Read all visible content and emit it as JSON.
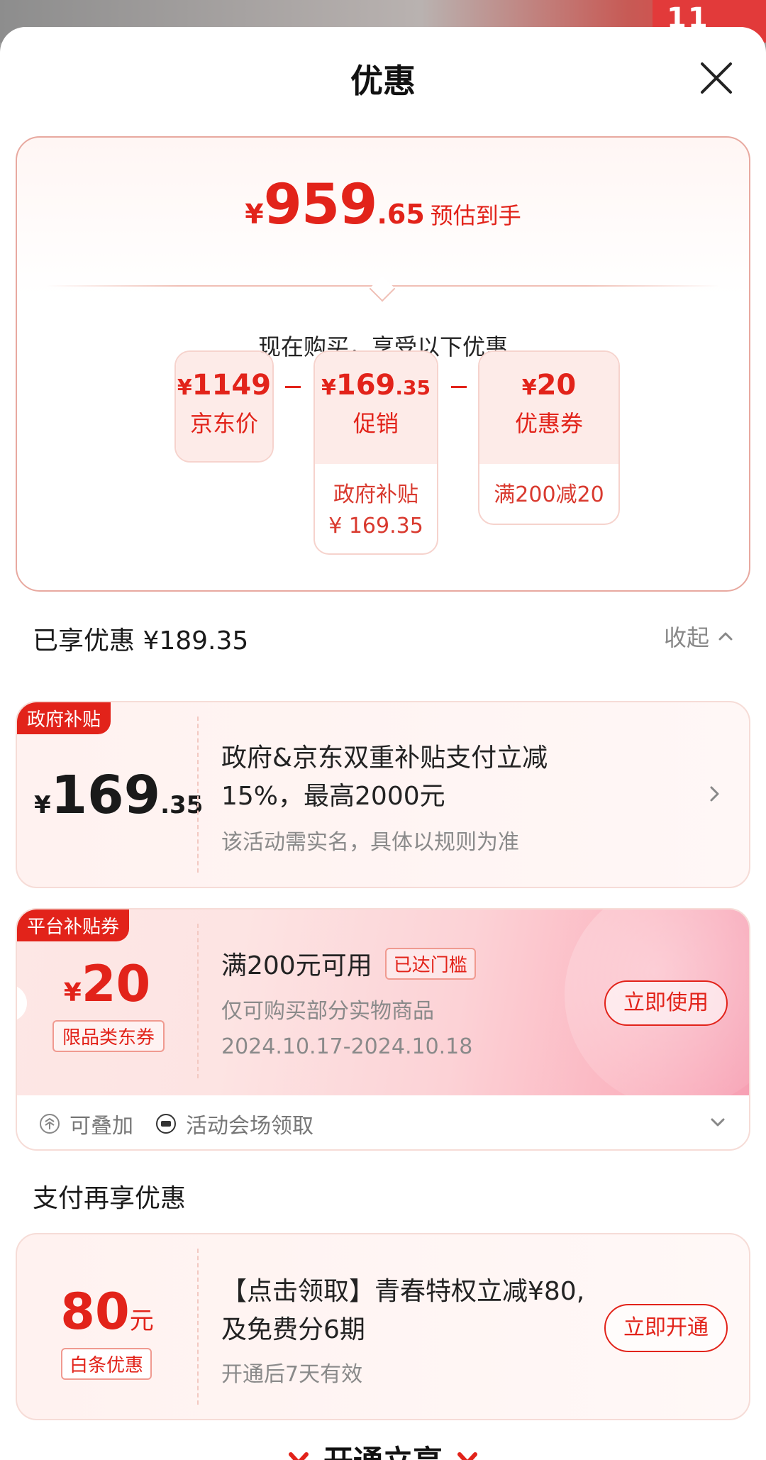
{
  "sheet": {
    "title": "优惠"
  },
  "summary": {
    "currency": "¥",
    "estimate_int": "959",
    "estimate_dec": ".65",
    "estimate_label": "预估到手",
    "buy_label": "现在购买，享受以下优惠",
    "boxes": [
      {
        "amount": "1149",
        "name": "京东价"
      },
      {
        "amount": "169",
        "amount_dec": ".35",
        "name": "促销",
        "detail_line1": "政府补贴",
        "detail_line2": "¥ 169.35"
      },
      {
        "amount": "20",
        "name": "优惠券",
        "detail_line1": "满200减20"
      }
    ]
  },
  "enjoyed": {
    "label": "已享优惠 ¥189.35",
    "collapse_label": "收起"
  },
  "gov_card": {
    "tag": "政府补贴",
    "currency": "¥",
    "amount_int": "169",
    "amount_dec": ".35",
    "desc": "政府&京东双重补贴支付立减15%，最高2000元",
    "sub": "该活动需实名，具体以规则为准"
  },
  "coupon_card": {
    "tag": "平台补贴券",
    "currency": "¥",
    "amount": "20",
    "scope": "限品类东券",
    "condition": "满200元可用",
    "reached": "已达门槛",
    "line2": "仅可购买部分实物商品",
    "line3": "2024.10.17-2024.10.18",
    "button": "立即使用",
    "meta_stackable": "可叠加",
    "meta_source": "活动会场领取"
  },
  "pay_section": {
    "title": "支付再享优惠"
  },
  "baitiao_card": {
    "amount": "80",
    "unit": "元",
    "scope": "白条优惠",
    "desc": "【点击领取】青春特权立减¥80,及免费分6期",
    "sub": "开通后7天有效",
    "button": "立即开通"
  },
  "bottom_cta": {
    "label": "开通立享"
  },
  "colors": {
    "accent": "#e2231a",
    "card_border": "#f6dcd7",
    "muted": "#8a8a8a"
  }
}
